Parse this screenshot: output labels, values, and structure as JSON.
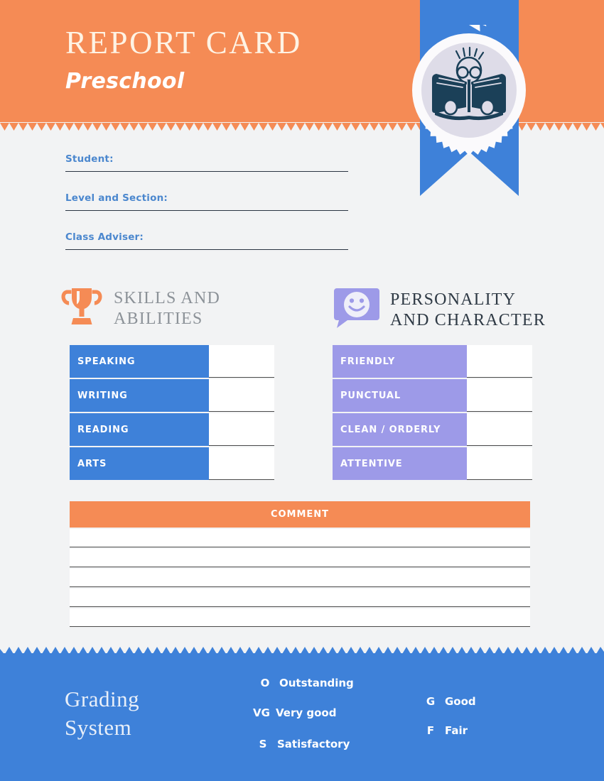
{
  "header": {
    "title": "REPORT CARD",
    "subtitle": "Preschool",
    "badge_icon": "child-reading-book-icon",
    "ribbon_icon": "ribbon-banner-icon",
    "colors": {
      "orange": "#F58B55",
      "blue": "#3E81D9",
      "purple": "#9D9AE8",
      "navy": "#1B4058",
      "badge_disk": "#DEDCE8",
      "page_bg": "#F2F3F4"
    }
  },
  "fields": [
    {
      "label": "Student:",
      "value": ""
    },
    {
      "label": "Level and Section:",
      "value": ""
    },
    {
      "label": "Class Adviser:",
      "value": ""
    }
  ],
  "sections": [
    {
      "key": "skills",
      "icon": "trophy-icon",
      "title_line1": "SKILLS AND",
      "title_line2": "ABILITIES",
      "rows": [
        {
          "label": "SPEAKING",
          "value": ""
        },
        {
          "label": "WRITING",
          "value": ""
        },
        {
          "label": "READING",
          "value": ""
        },
        {
          "label": "ARTS",
          "value": ""
        }
      ]
    },
    {
      "key": "personality",
      "icon": "smiley-speech-bubble-icon",
      "title_line1": "PERSONALITY",
      "title_line2": "AND CHARACTER",
      "rows": [
        {
          "label": "FRIENDLY",
          "value": ""
        },
        {
          "label": "PUNCTUAL",
          "value": ""
        },
        {
          "label": "CLEAN / ORDERLY",
          "value": ""
        },
        {
          "label": "ATTENTIVE",
          "value": ""
        }
      ]
    }
  ],
  "comment": {
    "header": "COMMENT",
    "lines": [
      "",
      "",
      "",
      "",
      ""
    ]
  },
  "grading": {
    "title_line1": "Grading",
    "title_line2": "System",
    "column_one": [
      {
        "code": "O",
        "desc": "Outstanding"
      },
      {
        "code": "VG",
        "desc": "Very good"
      },
      {
        "code": "S",
        "desc": "Satisfactory"
      }
    ],
    "column_two": [
      {
        "code": "G",
        "desc": "Good"
      },
      {
        "code": "F",
        "desc": "Fair"
      }
    ]
  }
}
